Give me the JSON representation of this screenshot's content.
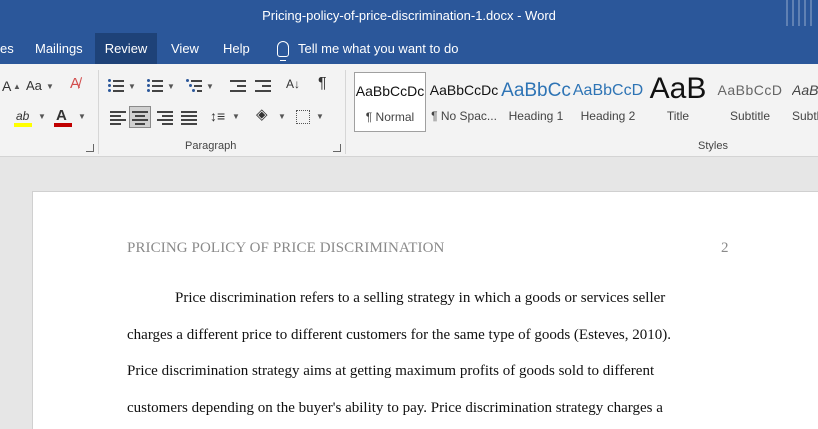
{
  "window": {
    "title": "Pricing-policy-of-price-discrimination-1.docx  -  Word"
  },
  "tabs": [
    {
      "label": "es"
    },
    {
      "label": "Mailings"
    },
    {
      "label": "Review"
    },
    {
      "label": "View"
    },
    {
      "label": "Help"
    }
  ],
  "tell_me": "Tell me what you want to do",
  "ribbon": {
    "font_group": {
      "change_case_label": "Aa"
    },
    "paragraph_label": "Paragraph",
    "styles_label": "Styles",
    "styles": [
      {
        "sample": "AaBbCcDc",
        "name": "¶ Normal"
      },
      {
        "sample": "AaBbCcDc",
        "name": "¶ No Spac..."
      },
      {
        "sample": "AaBbCc",
        "name": "Heading 1"
      },
      {
        "sample": "AaBbCcD",
        "name": "Heading 2"
      },
      {
        "sample": "AaB",
        "name": "Title"
      },
      {
        "sample": "AaBbCcD",
        "name": "Subtitle"
      },
      {
        "sample": "AaBb",
        "name": "Subtl"
      }
    ]
  },
  "document": {
    "header": "PRICING POLICY OF PRICE DISCRIMINATION",
    "page_number": "2",
    "lines": [
      "Price discrimination refers to a selling strategy in which a goods or services seller",
      "charges a different price to different customers for the same type of goods (Esteves, 2010).",
      "Price discrimination strategy aims at getting maximum profits of goods sold to different",
      "customers depending on the buyer's ability to pay. Price discrimination strategy charges a"
    ]
  },
  "colors": {
    "ribbon_blue": "#2b579a",
    "active_tab": "#1e4278",
    "heading_blue": "#2e74b5"
  }
}
